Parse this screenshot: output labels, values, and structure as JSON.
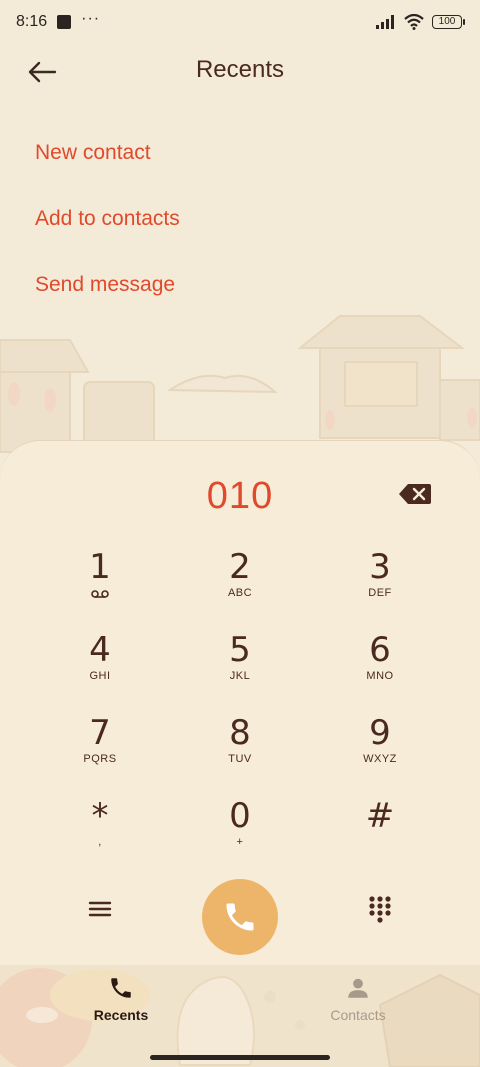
{
  "status": {
    "time": "8:16",
    "dots": "···",
    "battery": "100",
    "icons": [
      "notification-square-icon",
      "signal-icon",
      "wifi-icon",
      "battery-icon"
    ]
  },
  "header": {
    "title": "Recents",
    "back_icon": "back-arrow-icon"
  },
  "menu": {
    "items": [
      "New contact",
      "Add to contacts",
      "Send message"
    ]
  },
  "dialer": {
    "number": "010",
    "backspace_icon": "backspace-icon",
    "keys": [
      {
        "digit": "1",
        "sub": ""
      },
      {
        "digit": "2",
        "sub": "ABC"
      },
      {
        "digit": "3",
        "sub": "DEF"
      },
      {
        "digit": "4",
        "sub": "GHI"
      },
      {
        "digit": "5",
        "sub": "JKL"
      },
      {
        "digit": "6",
        "sub": "MNO"
      },
      {
        "digit": "7",
        "sub": "PQRS"
      },
      {
        "digit": "8",
        "sub": "TUV"
      },
      {
        "digit": "9",
        "sub": "WXYZ"
      },
      {
        "digit": "*",
        "sub": ","
      },
      {
        "digit": "0",
        "sub": "+"
      },
      {
        "digit": "#",
        "sub": ""
      }
    ]
  },
  "bottom_nav": {
    "recents_label": "Recents",
    "contacts_label": "Contacts"
  },
  "colors": {
    "accent": "#e04a2c",
    "call_button": "#edb56a",
    "background": "#f4ead8",
    "text": "#4a2a1e"
  }
}
